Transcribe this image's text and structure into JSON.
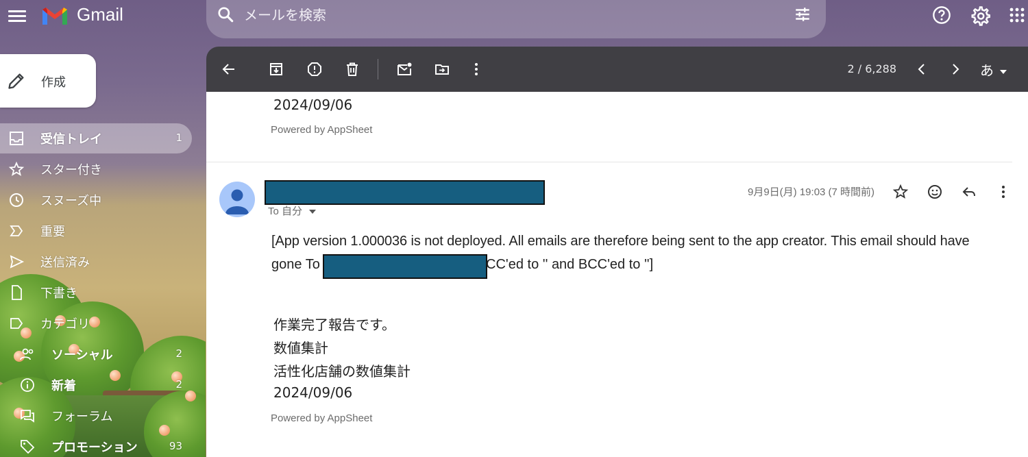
{
  "header": {
    "app_title": "Gmail",
    "search_placeholder": "メールを検索",
    "icons": [
      "menu-icon",
      "gmail-logo",
      "search-icon",
      "filter-icon",
      "help-icon",
      "gear-icon",
      "apps-icon"
    ]
  },
  "compose": {
    "label": "作成"
  },
  "sidebar": {
    "items": [
      {
        "label": "受信トレイ",
        "count": "1",
        "icon": "inbox-icon"
      },
      {
        "label": "スター付き",
        "count": "",
        "icon": "star-icon"
      },
      {
        "label": "スヌーズ中",
        "count": "",
        "icon": "clock-icon"
      },
      {
        "label": "重要",
        "count": "",
        "icon": "important-icon"
      },
      {
        "label": "送信済み",
        "count": "",
        "icon": "send-icon"
      },
      {
        "label": "下書き",
        "count": "",
        "icon": "draft-icon"
      },
      {
        "label": "カテゴリ",
        "count": "",
        "icon": "label-icon"
      },
      {
        "label": "ソーシャル",
        "count": "2",
        "icon": "people-icon"
      },
      {
        "label": "新着",
        "count": "2",
        "icon": "info-icon"
      },
      {
        "label": "フォーラム",
        "count": "",
        "icon": "forum-icon"
      },
      {
        "label": "プロモーション",
        "count": "93",
        "icon": "tag-icon"
      }
    ]
  },
  "toolbar": {
    "pager": "2 / 6,288",
    "input_tool": "あ",
    "icons": [
      "back-arrow-icon",
      "archive-icon",
      "report-spam-icon",
      "delete-icon",
      "mark-unread-icon",
      "move-to-icon",
      "more-vert-icon",
      "chevron-left-icon",
      "chevron-right-icon"
    ]
  },
  "email": {
    "prev_date": "2024/09/06",
    "prev_footer": "Powered by AppSheet",
    "timestamp": "9月9日(月) 19:03 (7 時間前)",
    "to_line": "To 自分",
    "body_line1": "[App version 1.000036 is not deployed. All emails are therefore being sent to the app creator. This email should have",
    "body_line2_prefix": "gone To",
    "body_line2_suffix": "CC'ed to '' and BCC'ed to '']",
    "lines": [
      "作業完了報告です。",
      "数値集計",
      "活性化店舗の数値集計",
      "2024/09/06"
    ],
    "footer": "Powered by AppSheet"
  }
}
